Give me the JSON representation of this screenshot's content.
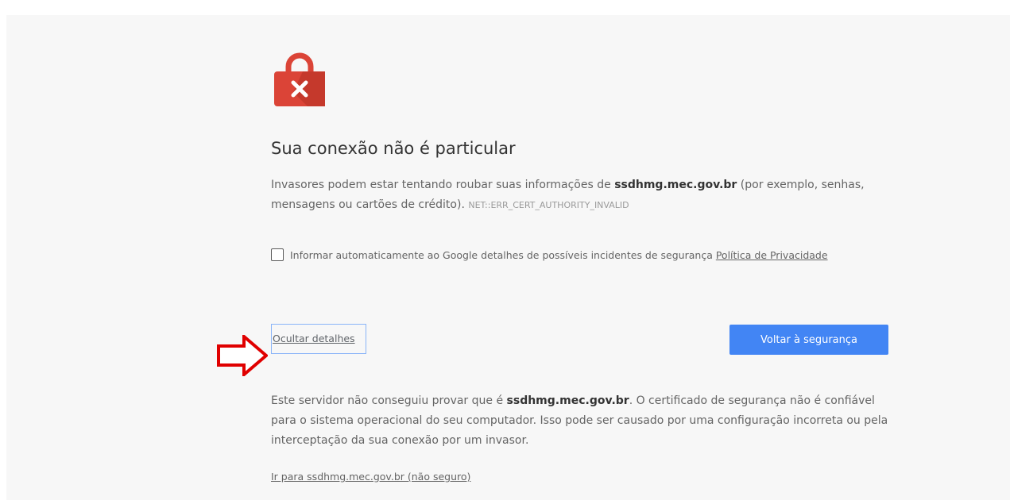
{
  "page": {
    "title": "Sua conexão não é particular",
    "intro_part1": "Invasores podem estar tentando roubar suas informações de ",
    "intro_domain": "ssdhmg.mec.gov.br",
    "intro_part2": " (por exemplo, senhas, mensagens ou cartões de crédito). ",
    "error_code": "NET::ERR_CERT_AUTHORITY_INVALID",
    "report_text": "Informar automaticamente ao Google detalhes de possíveis incidentes de segurança ",
    "privacy_link": "Política de Privacidade",
    "details_button": "Ocultar detalhes",
    "back_button": "Voltar à segurança",
    "explain_part1": "Este servidor não conseguiu provar que é ",
    "explain_domain": "ssdhmg.mec.gov.br",
    "explain_part2": ". O certificado de segurança não é confiável para o sistema operacional do seu computador. Isso pode ser causado por uma configuração incorreta ou pela interceptação da sua conexão por um invasor.",
    "proceed_link": "Ir para ssdhmg.mec.gov.br (não seguro)"
  },
  "icons": {
    "lock": "lock-error-icon",
    "arrow": "red-arrow-icon"
  },
  "colors": {
    "lock_red": "#db4437",
    "primary_blue": "#4285f4",
    "arrow_red": "#e00000"
  }
}
